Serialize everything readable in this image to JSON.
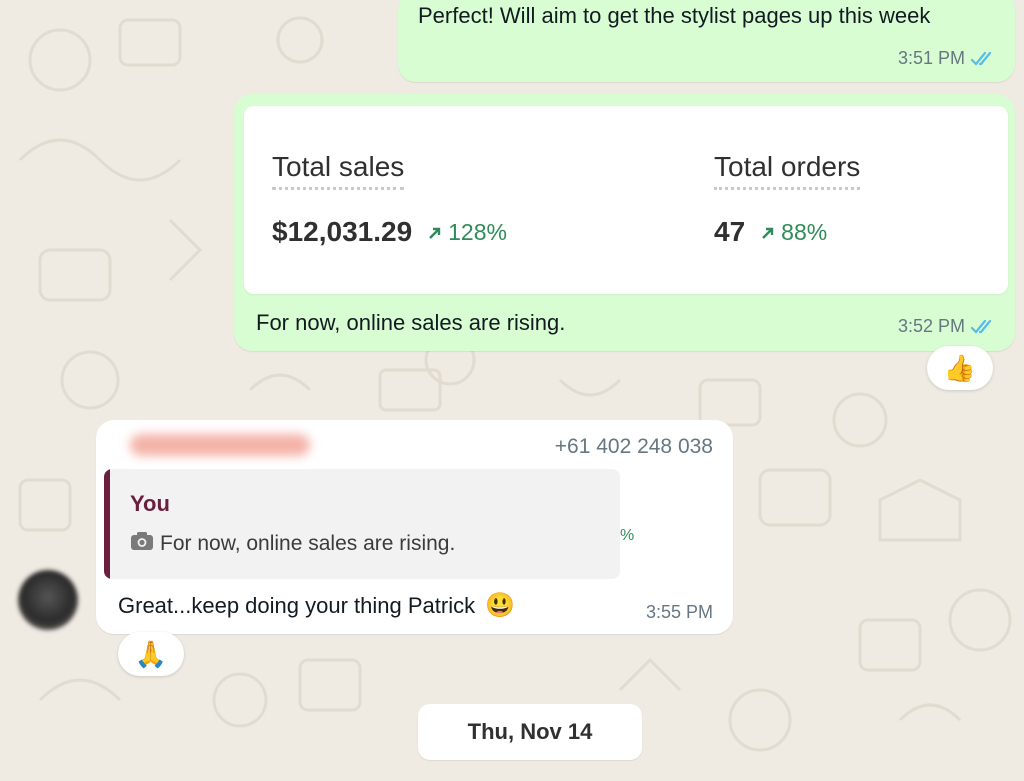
{
  "messages": {
    "m1": {
      "text": "Perfect! Will aim to get the stylist pages up this week",
      "time": "3:51 PM"
    },
    "m2": {
      "stats": {
        "sales_label": "Total sales",
        "sales_value": "$12,031.29",
        "sales_delta": "128%",
        "orders_label": "Total orders",
        "orders_value": "47",
        "orders_delta": "88%"
      },
      "caption": "For now, online sales are rising.",
      "time": "3:52 PM",
      "reaction": "👍"
    },
    "m3": {
      "sender_phone": "+61 402 248 038",
      "quote_author": "You",
      "quote_text": "For now, online sales are rising.",
      "quote_thumb_fragment": "%",
      "text": "Great...keep doing your thing Patrick",
      "emoji": "😃",
      "time": "3:55 PM",
      "reaction": "🙏"
    }
  },
  "date_divider": "Thu, Nov 14",
  "colors": {
    "outgoing": "#d9fdd3",
    "incoming": "#ffffff",
    "tick_read": "#53bdeb",
    "delta_green": "#2f8c58",
    "quote_bar": "#6b1f3e"
  }
}
